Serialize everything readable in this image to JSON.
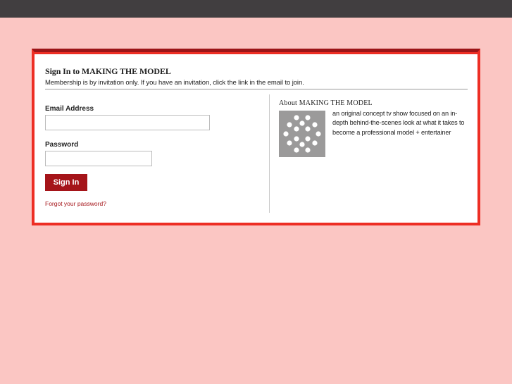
{
  "login": {
    "title": "Sign In to MAKING THE MODEL",
    "subtitle": "Membership is by invitation only. If you have an invitation, click the link in the email to join.",
    "email_label": "Email Address",
    "email_value": "",
    "password_label": "Password",
    "password_value": "",
    "signin_label": "Sign In",
    "forgot_label": "Forgot your password?"
  },
  "about": {
    "title": "About MAKING THE MODEL",
    "description": "an original concept tv show focused on an in-depth behind-the-scenes look at what it takes to become a professional model + entertainer",
    "image_icon": "dotted-circle-logo-icon"
  },
  "colors": {
    "background": "#fbc6c3",
    "topbar": "#413e40",
    "frame": "#ed2e24",
    "frame_top": "#9b1518",
    "accent": "#a51419"
  }
}
